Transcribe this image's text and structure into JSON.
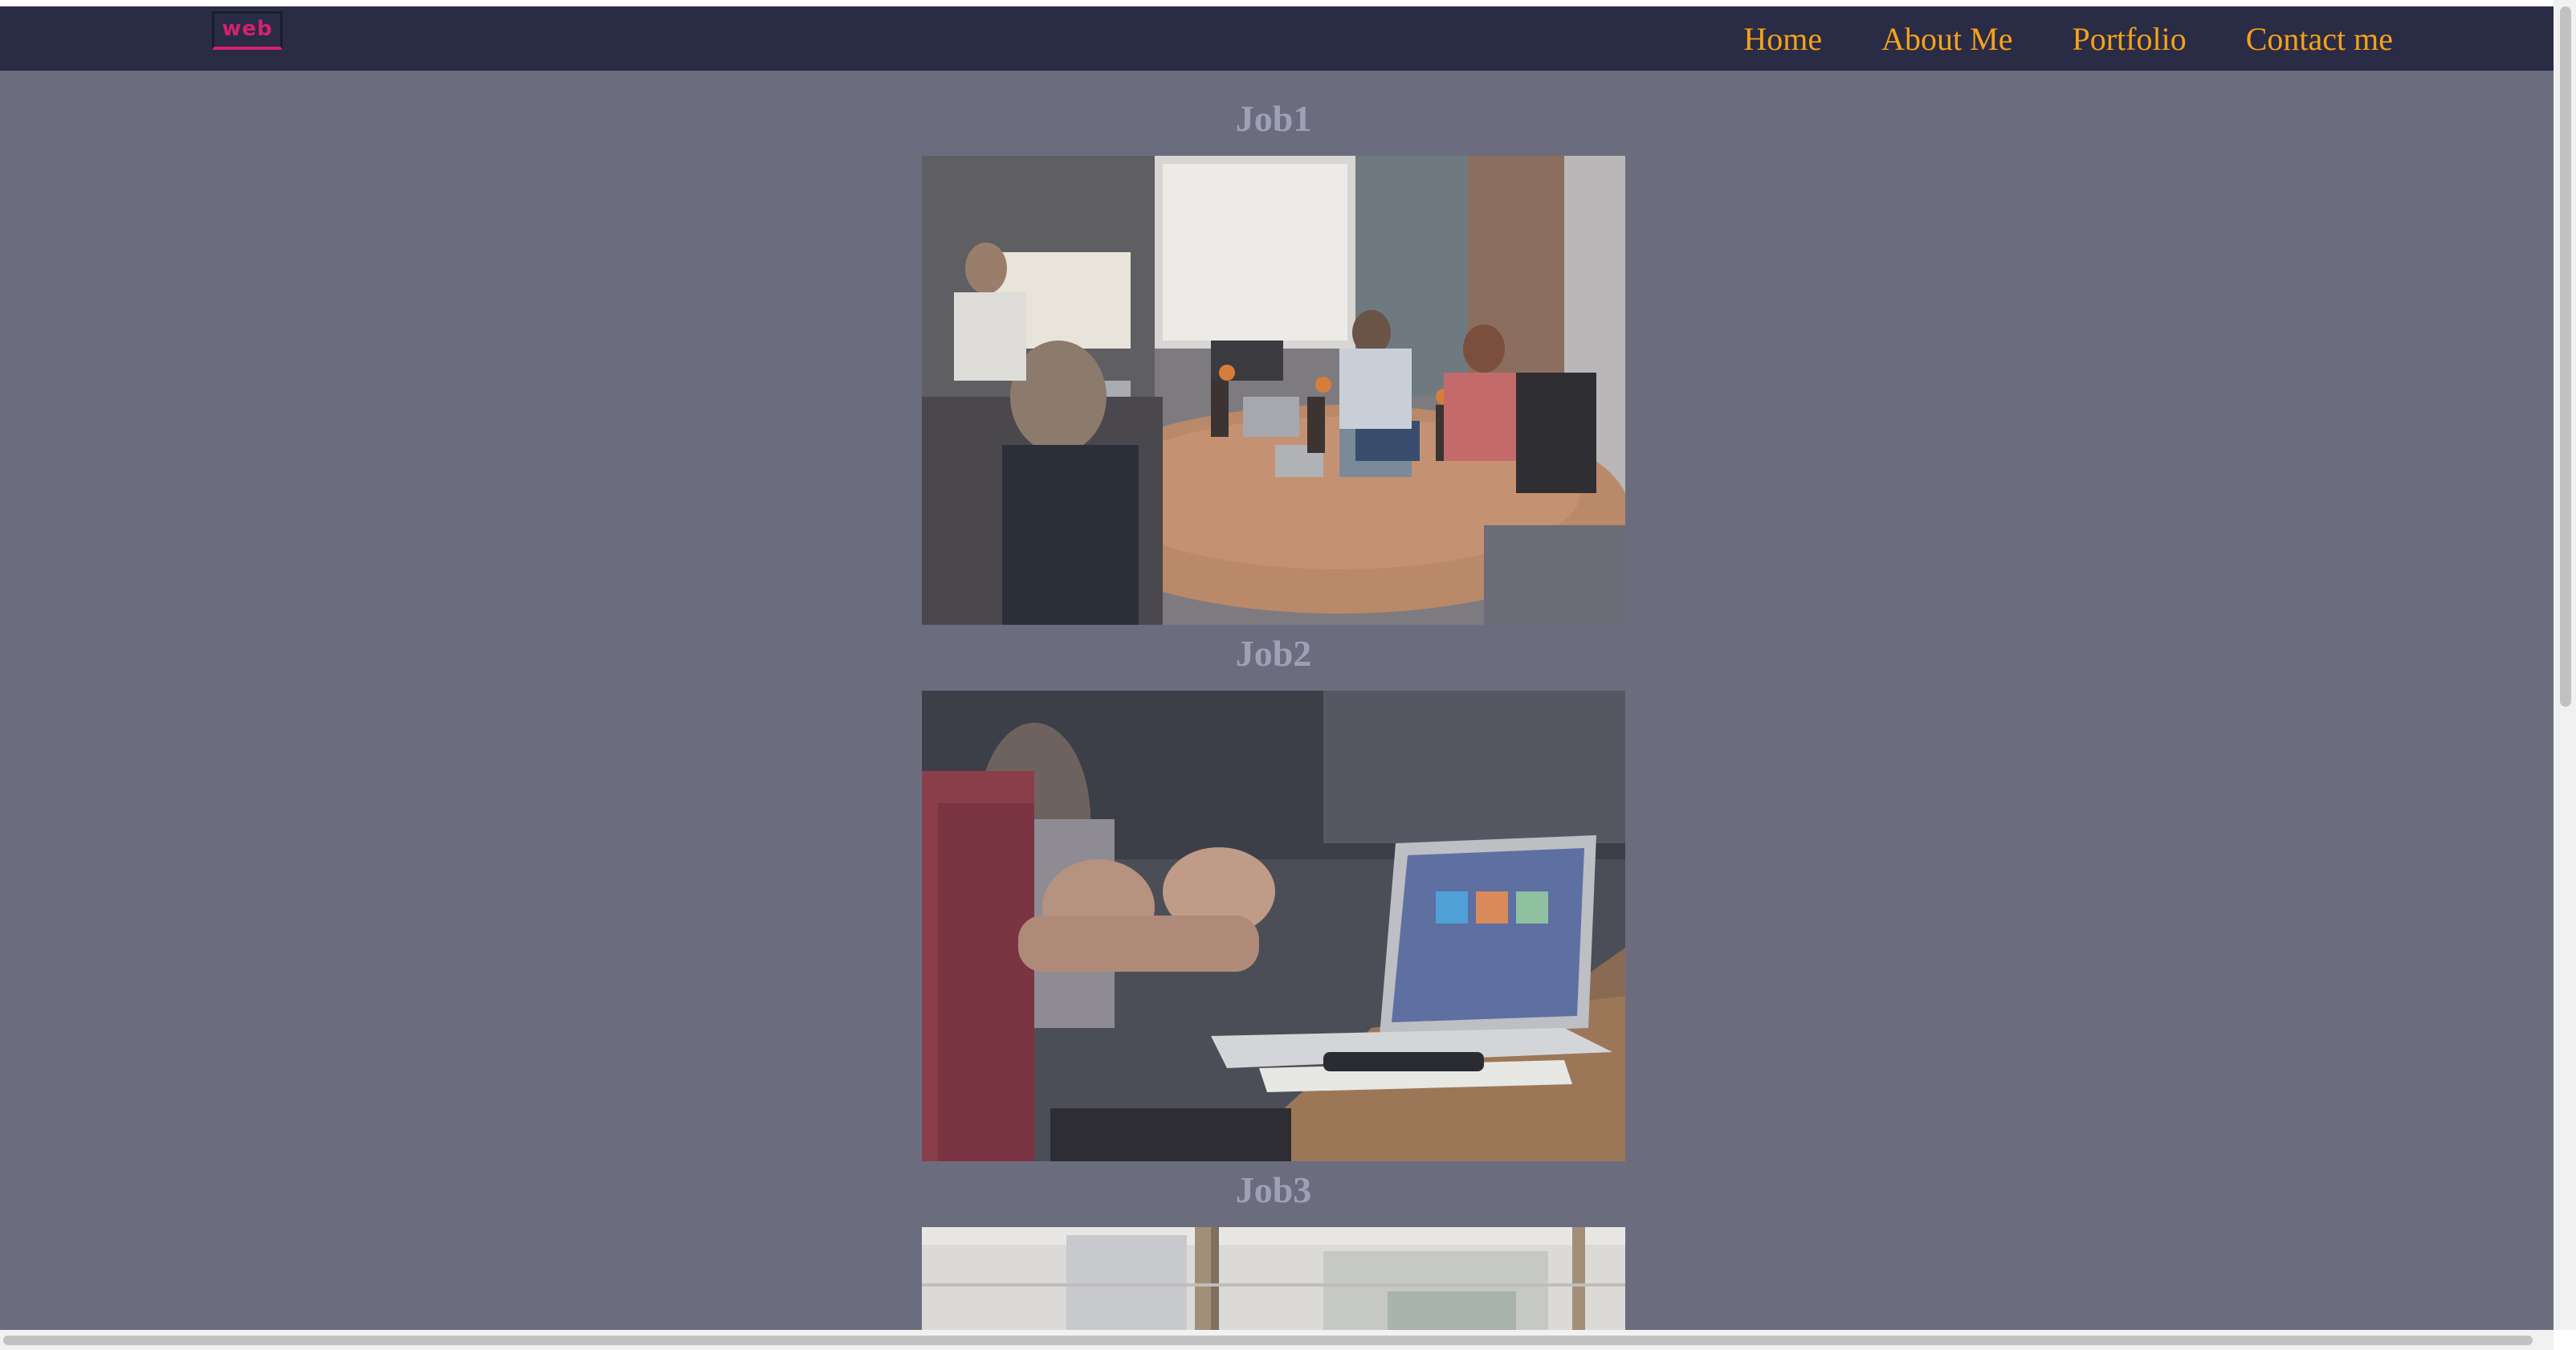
{
  "navbar": {
    "logo_text": "web",
    "links": [
      {
        "label": "Home"
      },
      {
        "label": "About Me"
      },
      {
        "label": "Portfolio"
      },
      {
        "label": "Contact me"
      }
    ]
  },
  "portfolio": {
    "jobs": [
      {
        "title": "Job1",
        "image": "meeting-presentation-photo"
      },
      {
        "title": "Job2",
        "image": "laptop-discussion-photo"
      },
      {
        "title": "Job3",
        "image": "office-window-photo"
      }
    ]
  },
  "colors": {
    "page_background": "#6b6d7e",
    "navbar_background": "#2a2b45",
    "nav_link": "#f4a21a",
    "logo_accent": "#d4226e",
    "job_title": "#9ea0b6"
  }
}
